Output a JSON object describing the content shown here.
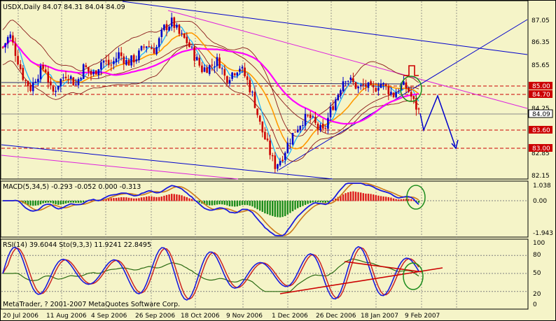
{
  "colors": {
    "background": "#f5f4c8",
    "grid": "#7f7f7f",
    "bull_candle": "#0000cc",
    "bear_candle": "#cc0000",
    "bollinger": "#8b1a1a",
    "ema_fast": "#1eb4ff",
    "ema_mid": "#ff9900",
    "ema_slow": "#ff00ff",
    "trend_blue": "#0000cc",
    "trend_magenta": "#dd22dd",
    "level_red": "#cc0000",
    "highlight_green": "#1c8c1c",
    "macd_signal": "#cc7a1a",
    "rsi_line": "#2b6b12",
    "stoch_main": "#1a1add",
    "stoch_signal": "#cc2222",
    "histo_pos": "#dd1c1c",
    "histo_neg": "#1c8c1c"
  },
  "main_panel": {
    "title": "USDX,Daily  84.07 84.31 84.04 84.09",
    "price_axis_labels": [
      "87.05",
      "86.35",
      "85.65",
      "84.95",
      "84.25",
      "83.55",
      "82.85",
      "82.15"
    ],
    "marked_levels": [
      "85.00",
      "84.70",
      "83.60",
      "83.00"
    ],
    "current_price": "84.09"
  },
  "macd_panel": {
    "title": "MACD(5,34,5) -0.293 -0.052 0.000 -0.313",
    "axis_labels": [
      "1.038",
      "0.00",
      "-1.943"
    ]
  },
  "rsi_panel": {
    "title": "RSI(14) 39.6044  Sto(9,3,3) 11.9241 22.8495",
    "axis_labels": [
      "100",
      "80",
      "50",
      "20",
      "0"
    ],
    "watermark": "MetaTrader, ? 2001-2007 MetaQuotes Software Corp."
  },
  "time_axis": [
    "20 Jul 2006",
    "11 Aug 2006",
    "4 Sep 2006",
    "26 Sep 2006",
    "18 Oct 2006",
    "9 Nov 2006",
    "1 Dec 2006",
    "26 Dec 2006",
    "18 Jan 2007",
    "9 Feb 2007"
  ],
  "chart_data": {
    "type": "candlestick",
    "series": [
      {
        "name": "USDX",
        "values": []
      }
    ]
  }
}
